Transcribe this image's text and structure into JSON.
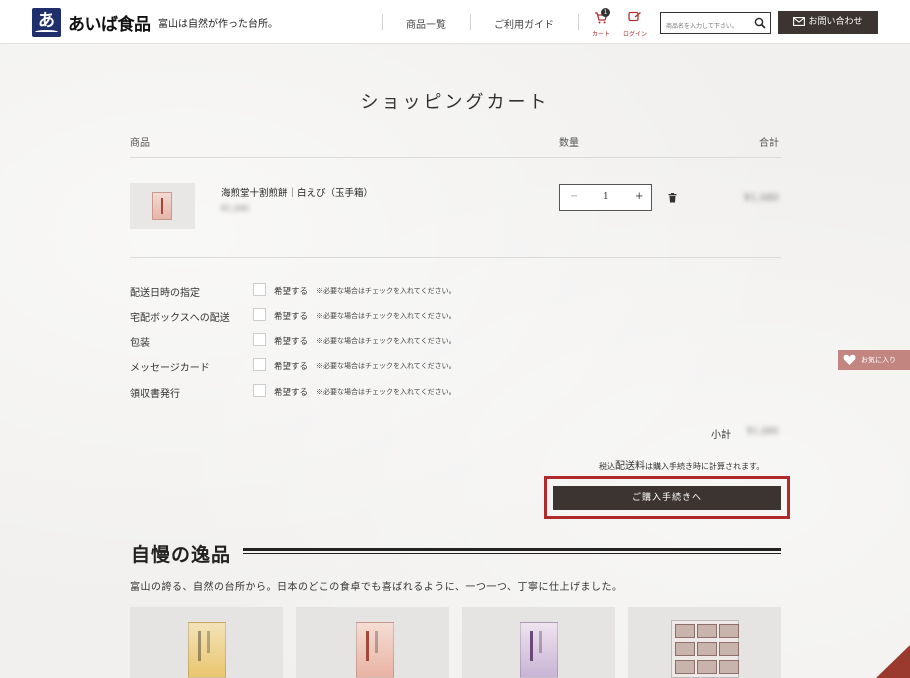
{
  "header": {
    "logo_mark": "あ",
    "logo_text": "あいば食品",
    "tagline": "富山は自然が作った台所。",
    "nav": [
      "商品一覧",
      "ご利用ガイド"
    ],
    "cart_label": "カート",
    "cart_count": "1",
    "login_label": "ログイン",
    "search_placeholder": "商品名を入力して下さい。",
    "contact_label": "お問い合わせ"
  },
  "cart": {
    "title": "ショッピングカート",
    "col_product": "商品",
    "col_qty": "数量",
    "col_total": "合計",
    "item": {
      "name": "海煎堂十割煎餅｜白えび（玉手箱）",
      "unit_price": "¥1,080",
      "quantity": "1",
      "line_total": "¥1,080",
      "minus": "−",
      "plus": "+"
    },
    "options": [
      {
        "label": "配送日時の指定",
        "want": "希望する",
        "note": "※必要な場合はチェックを入れてください。"
      },
      {
        "label": "宅配ボックスへの配送",
        "want": "希望する",
        "note": "※必要な場合はチェックを入れてください。"
      },
      {
        "label": "包装",
        "want": "希望する",
        "note": "※必要な場合はチェックを入れてください。"
      },
      {
        "label": "メッセージカード",
        "want": "希望する",
        "note": "※必要な場合はチェックを入れてください。"
      },
      {
        "label": "領収書発行",
        "want": "希望する",
        "note": "※必要な場合はチェックを入れてください。"
      }
    ],
    "subtotal_label": "小計",
    "subtotal_value": "¥1,080",
    "shipping_prefix": "税込",
    "shipping_bold": "配送料",
    "shipping_suffix": "は購入手続き時に計算されます。",
    "checkout_label": "ご購入手続きへ"
  },
  "featured": {
    "title": "自慢の逸品",
    "description": "富山の誇る、自然の台所から。日本のどこの食卓でも喜ばれるように、一つ一つ、丁寧に仕上げました。"
  },
  "favorite_tab": "お気に入り",
  "colors": {
    "accent": "#b02a2a",
    "button_dark": "#3b3431",
    "logo_navy": "#1f2f6b",
    "favorite": "#c28580"
  }
}
